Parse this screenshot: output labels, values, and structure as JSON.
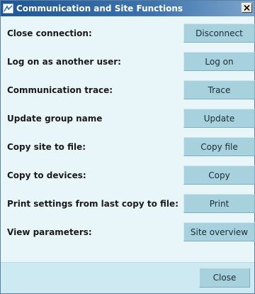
{
  "window": {
    "title": "Communication and Site Functions",
    "close_glyph": "×"
  },
  "rows": [
    {
      "label": "Close connection:",
      "button": "Disconnect"
    },
    {
      "label": "Log on as another user:",
      "button": "Log on"
    },
    {
      "label": "Communication trace:",
      "button": "Trace"
    },
    {
      "label": "Update group name",
      "button": "Update"
    },
    {
      "label": "Copy site to file:",
      "button": "Copy file"
    },
    {
      "label": "Copy to devices:",
      "button": "Copy"
    },
    {
      "label": "Print settings from last copy to file:",
      "button": "Print"
    },
    {
      "label": "View parameters:",
      "button": "Site overview"
    }
  ],
  "footer": {
    "close_label": "Close"
  },
  "colors": {
    "titlebar": "#1f5694",
    "panel": "#e8f6fa",
    "button": "#a6d1dd",
    "footer": "#cde9f2"
  }
}
